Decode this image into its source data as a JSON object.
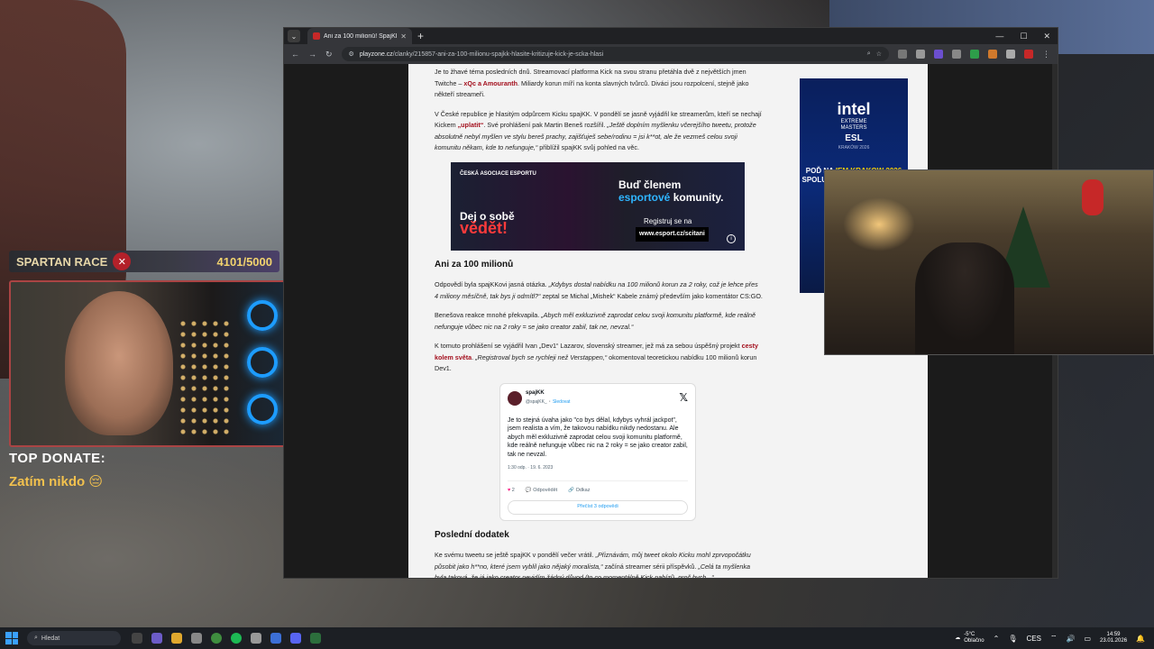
{
  "overlay": {
    "goal_title": "SPARTAN RACE",
    "goal_progress": "4101/5000",
    "donate_title": "TOP DONATE:",
    "donate_value": "Zatím nikdo 😔"
  },
  "browser": {
    "tab_title": "Ani za 100 milionů! SpajKK hlási",
    "url_domain": "playzone.cz",
    "url_path": "/clanky/215857-ani-za-100-milionu-spajkk-hlasite-kritizuje-kick-je-scka-hlasi"
  },
  "article": {
    "p1_a": "Je to žhavé téma posledních dnů. Streamovací platforma Kick na svou stranu přetáhla dvě z největších jmen Twitche –",
    "p1_link": "xQc a Amouranth",
    "p1_b": ". Miliardy korun míří na konta slavných tvůrců. Diváci jsou rozpolcení, stejně jako někteří streameři.",
    "p2_a": "V České republice je hlasitým odpůrcem Kicku spajKK. V pondělí se jasně vyjádřil ke streamerům, kteří se nechají Kickem",
    "p2_link": "„uplatit“",
    "p2_b": ". Své prohlášení pak Martin Beneš rozšířil.",
    "p2_quote": "„Ještě doplním myšlenku včerejšího tweetu, protože absolutně nebyl myšlen ve stylu bereš prachy, zajišťuješ sebe/rodinu = jsi k**ot, ale že vezmeš celou svoji komunitu někam, kde to nefunguje,“",
    "p2_c": "přiblížil spajKK svůj pohled na věc.",
    "heading1": "Ani za 100 milionů",
    "p3_a": "Odpovědí byla spajKKovi jasná otázka.",
    "p3_quote": "„Kdybys dostal nabídku na 100 milionů korun za 2 roky, což je lehce přes 4 miliony měsíčně, tak bys ji odmítl?“",
    "p3_b": "zeptal se Michal „Mishek“ Kabele známý především jako komentátor CS:GO.",
    "p4_a": "Benešova reakce mnohé překvapila.",
    "p4_quote": "„Abych měl exkluzivně zaprodat celou svoji komunitu platformě, kde reálně nefunguje vůbec nic na 2 roky = se jako creator zabil, tak ne, nevzal.“",
    "p5_a": "K tomuto prohlášení se vyjádřil Ivan „Dev1“ Lazarov, slovenský streamer, jež má za sebou úspěšný projekt",
    "p5_link": "cesty kolem světa",
    "p5_b": ".",
    "p5_quote": "„Registroval bych se rychleji než Verstappen,“",
    "p5_c": "okomentoval teoretickou nabídku 100 milionů korun Dev1.",
    "heading2": "Poslední dodatek",
    "p6_a": "Ke svému tweetu se ještě spajKK v pondělí večer vrátil.",
    "p6_quote": "„Přiznávám, můj tweet okolo Kicku mohl zprvopočátku působit jako h**no, které jsem vyblil jako nějaký moralista,“",
    "p6_b": "začíná streamer sérii příspěvků.",
    "p6_quote2": "„Celá ta myšlenka byla taková, že já jako creator nevidím žádný důvod (to co momentálně Kick nabízí), proč bych...“"
  },
  "ad_banner": {
    "org": "ČESKÁ ASOCIACE ESPORTU",
    "slogan_line1": "Dej o sobě",
    "slogan_line2": "vědět!",
    "right_line1": "Buď členem",
    "right_line2_accent": "esportové",
    "right_line2_rest": "komunity.",
    "register": "Registruj se na",
    "url": "www.esport.cz/scitani"
  },
  "tweet": {
    "name": "spajKK",
    "handle": "@spajKK_",
    "follow": "Sledovat",
    "text": "Je to stejná úvaha jako \"co bys dělal, kdybys vyhrál jackpot\", jsem realista a vím, že takovou nabídku nikdy nedostanu. Ale abych měl exkluzivně zaprodat celou svoji komunitu platformě, kde reálně nefunguje vůbec nic na 2 roky = se jako creator zabil, tak ne nevzal.",
    "date": "1:30 odp. · 19. 6. 2023",
    "likes": "2",
    "reply": "Odpovědět",
    "copy": "Odkaz",
    "read_more": "Přečíst 3 odpovědi"
  },
  "side_ad": {
    "brand": "intel",
    "event_line1": "EXTREME",
    "event_line2": "MASTERS",
    "esl": "ESL",
    "city": "KRAKÓW 2026",
    "promo_line1": "POĎ NA",
    "promo_accent": "IEM KRAKOW 2026",
    "promo_line2": "SPOLU S DEV1M A TURNAGO"
  },
  "taskbar": {
    "search_placeholder": "Hledat",
    "weather_temp": "-5°C",
    "weather_desc": "Oblačno",
    "lang": "CES",
    "time": "14:59",
    "date": "23.01.2026"
  }
}
